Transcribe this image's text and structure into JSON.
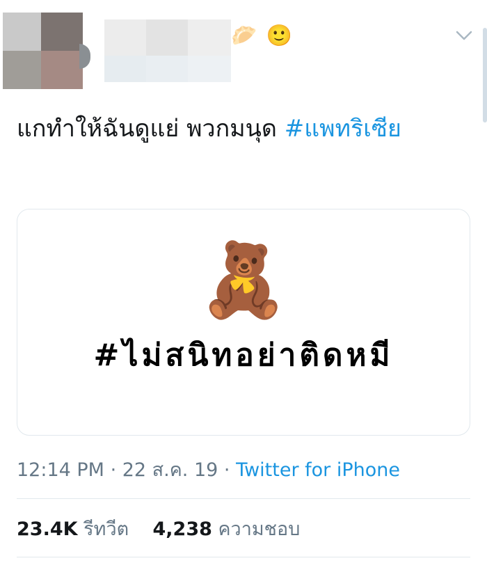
{
  "header": {
    "name_emojis": "🥟 🙂",
    "menu_icon": "chevron-down-icon"
  },
  "tweet": {
    "text": "แกทำให้ฉันดูแย่ พวกมนุด ",
    "hashtag": "#แพทริเซีย"
  },
  "card": {
    "emoji": "🧸",
    "hashtag": "#ไม่สนิทอย่าติดหมี"
  },
  "meta": {
    "time": "12:14 PM",
    "separator1": " · ",
    "date": "22 ส.ค. 19",
    "separator2": " · ",
    "source": "Twitter for iPhone"
  },
  "stats": {
    "retweets_count": "23.4K",
    "retweets_label": "รีทวีต",
    "likes_count": "4,238",
    "likes_label": "ความชอบ"
  },
  "colors": {
    "link": "#1b95e0",
    "muted": "#657786",
    "border": "#e1e8ed"
  }
}
